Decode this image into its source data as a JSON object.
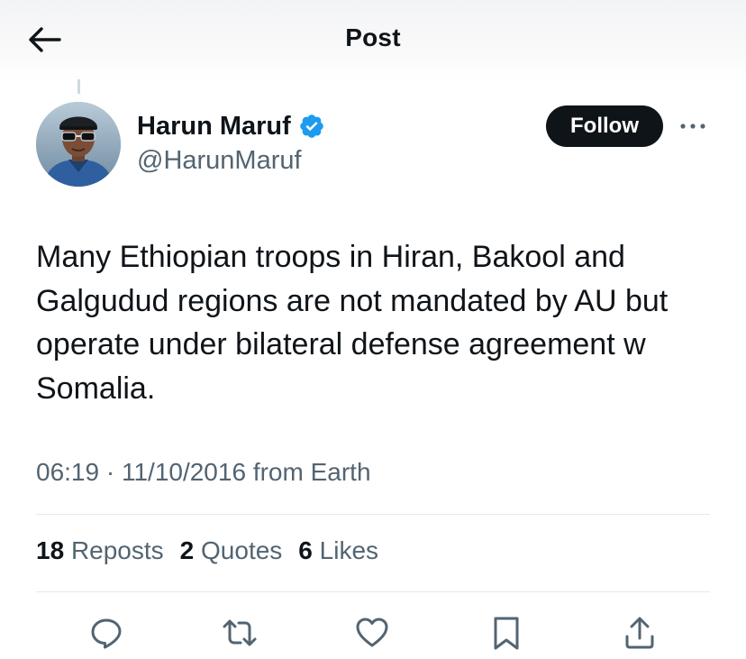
{
  "header": {
    "title": "Post",
    "back_icon": "arrow-left-icon"
  },
  "author": {
    "display_name": "Harun Maruf",
    "handle": "@HarunMaruf",
    "verified": true,
    "verified_color": "#1d9bf0"
  },
  "follow_button": {
    "label": "Follow"
  },
  "more_icon": "more-horizontal-icon",
  "tweet": {
    "text": "Many Ethiopian troops in Hiran, Bakool and Galgudud regions are not mandated by AU but operate under bilateral defense agreement w Somalia.",
    "time": "06:19",
    "separator": "·",
    "date": "11/10/2016",
    "source": "from Earth"
  },
  "stats": {
    "reposts": {
      "count": "18",
      "label": "Reposts"
    },
    "quotes": {
      "count": "2",
      "label": "Quotes"
    },
    "likes": {
      "count": "6",
      "label": "Likes"
    }
  },
  "actions": [
    {
      "name": "reply",
      "icon": "reply-icon"
    },
    {
      "name": "repost",
      "icon": "repost-icon"
    },
    {
      "name": "like",
      "icon": "heart-icon"
    },
    {
      "name": "bookmark",
      "icon": "bookmark-icon"
    },
    {
      "name": "share",
      "icon": "share-icon"
    }
  ],
  "colors": {
    "text_primary": "#0f1419",
    "text_secondary": "#536471",
    "divider": "#e5e8eb",
    "follow_bg": "#0f1419"
  }
}
